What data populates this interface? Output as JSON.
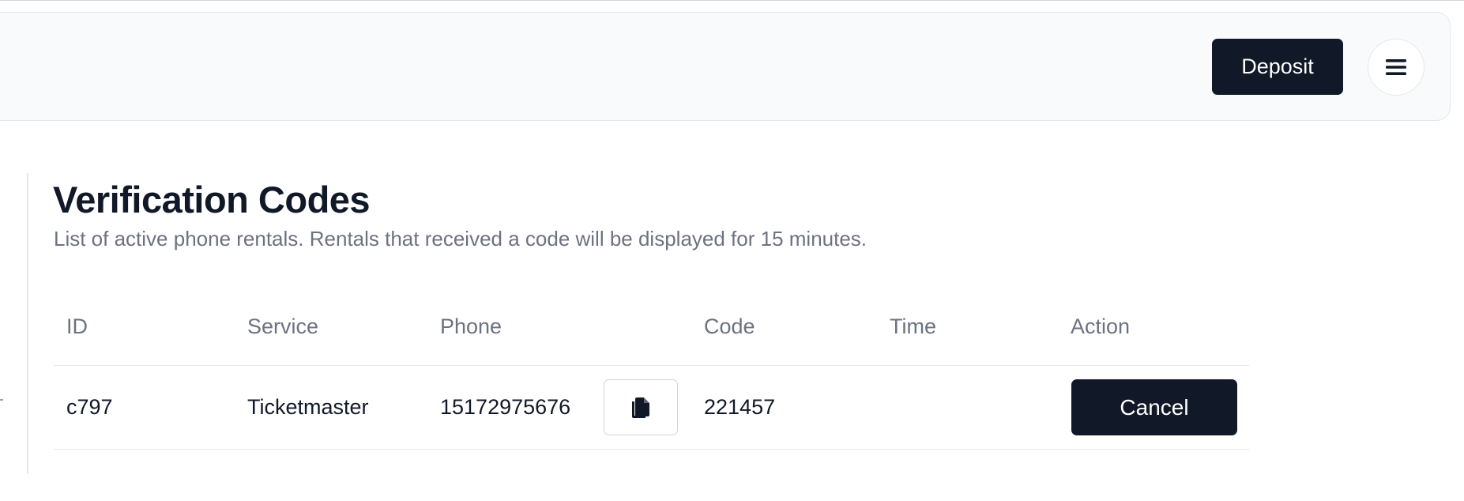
{
  "header": {
    "deposit_label": "Deposit",
    "menu_icon": "hamburger-menu-icon"
  },
  "main": {
    "title": "Verification Codes",
    "subtitle": "List of active phone rentals. Rentals that received a code will be displayed for 15 minutes."
  },
  "table": {
    "columns": [
      "ID",
      "Service",
      "Phone",
      "Code",
      "Time",
      "Action"
    ],
    "rows": [
      {
        "id": "c797",
        "service": "Ticketmaster",
        "phone": "15172975676",
        "copy_icon": "copy-icon",
        "code": "221457",
        "time": "",
        "action_label": "Cancel"
      }
    ]
  },
  "colors": {
    "primary": "#111827",
    "muted_text": "#6b7280",
    "border": "#e5e7eb",
    "header_bg": "#f9fafb"
  }
}
